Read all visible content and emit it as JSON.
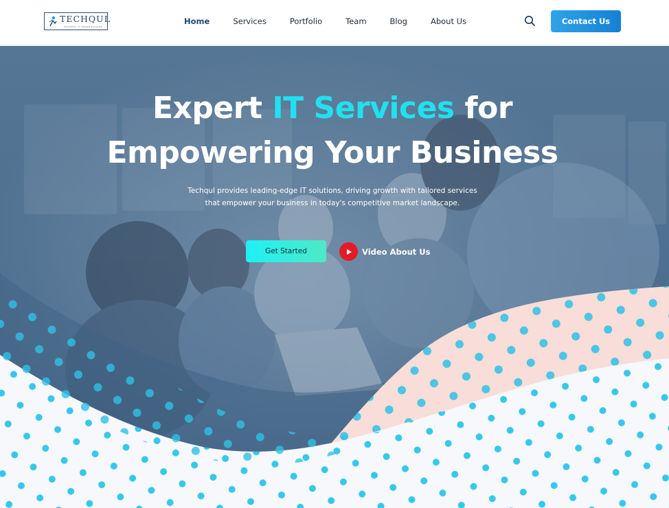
{
  "header": {
    "logo": {
      "name": "TECHQUL",
      "tagline": "TECHQUL IT TECHNOLOGIES"
    },
    "nav": [
      {
        "label": "Home",
        "active": true
      },
      {
        "label": "Services"
      },
      {
        "label": "Portfolio"
      },
      {
        "label": "Team"
      },
      {
        "label": "Blog"
      },
      {
        "label": "About Us"
      }
    ],
    "contact_label": "Contact Us"
  },
  "hero": {
    "title_part1": "Expert ",
    "title_accent": "IT Services",
    "title_part2": " for",
    "title_line2": "Empowering Your Business",
    "description": "Techqul provides leading-edge IT solutions, driving growth with tailored services that empower your business in today's competitive market landscape.",
    "primary_cta": "Get Started",
    "video_cta": "Video About Us"
  },
  "colors": {
    "accent": "#22e0ee",
    "brand": "#1580d6",
    "overlay": "#4f7190",
    "play": "#e21b27",
    "dots": "#31c6e8",
    "pink_wave": "#f8ddd8"
  },
  "icons": {
    "search": "search-icon",
    "play": "play-icon",
    "logo": "logo-mark-icon"
  }
}
